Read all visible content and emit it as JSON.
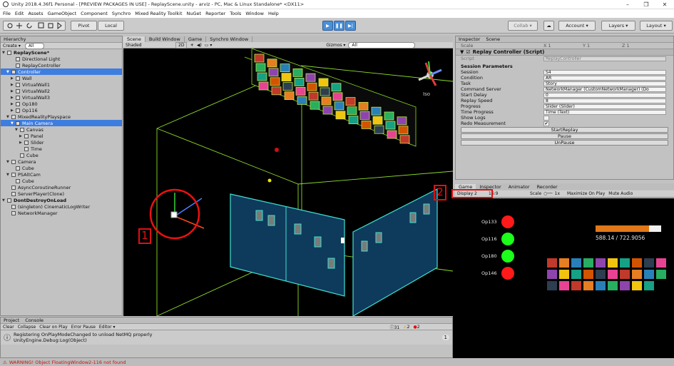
{
  "window": {
    "title": "Unity 2018.4.36f1 Personal - [PREVIEW PACKAGES IN USE] - ReplayScene.unity - arviz - PC, Mac & Linux Standalone* <DX11>",
    "controls": [
      "–",
      "❐",
      "✕"
    ]
  },
  "menu": [
    "File",
    "Edit",
    "Assets",
    "GameObject",
    "Component",
    "Synchro",
    "Mixed Reality Toolkit",
    "NuGet",
    "Reporter",
    "Tools",
    "Window",
    "Help"
  ],
  "toolbar": {
    "pivot": "Pivot",
    "local": "Local",
    "collab": "Collab ▾",
    "account": "Account ▾",
    "layers": "Layers ▾",
    "layout": "Layout ▾"
  },
  "hierarchy": {
    "tab": "Hierarchy",
    "create": "Create ▾",
    "search": "All",
    "rows": [
      {
        "text": "ReplayScene*",
        "indent": 0,
        "tri": "▼",
        "sel": false,
        "bold": true
      },
      {
        "text": "Directional Light",
        "indent": 2,
        "tri": "",
        "sel": false
      },
      {
        "text": "ReplayController",
        "indent": 2,
        "tri": "",
        "sel": false
      },
      {
        "text": "Controller",
        "indent": 1,
        "tri": "▼",
        "sel": true
      },
      {
        "text": "Wall",
        "indent": 2,
        "tri": "▶",
        "sel": false
      },
      {
        "text": "VirtualWall1",
        "indent": 2,
        "tri": "▶",
        "sel": false
      },
      {
        "text": "VirtualWall2",
        "indent": 2,
        "tri": "▶",
        "sel": false
      },
      {
        "text": "VirtualWall3",
        "indent": 2,
        "tri": "▶",
        "sel": false
      },
      {
        "text": "Op180",
        "indent": 2,
        "tri": "▶",
        "sel": false
      },
      {
        "text": "Op116",
        "indent": 2,
        "tri": "▶",
        "sel": false
      },
      {
        "text": "MixedRealityPlayspace",
        "indent": 1,
        "tri": "▼",
        "sel": false
      },
      {
        "text": "Main Camera",
        "indent": 2,
        "tri": "▼",
        "sel": true
      },
      {
        "text": "Canvas",
        "indent": 3,
        "tri": "▼",
        "sel": false
      },
      {
        "text": "Panel",
        "indent": 4,
        "tri": "▶",
        "sel": false
      },
      {
        "text": "Slider",
        "indent": 4,
        "tri": "▶",
        "sel": false
      },
      {
        "text": "Time",
        "indent": 4,
        "tri": "",
        "sel": false
      },
      {
        "text": "Cube",
        "indent": 3,
        "tri": "",
        "sel": false
      },
      {
        "text": "Camera",
        "indent": 1,
        "tri": "▼",
        "sel": false
      },
      {
        "text": "Cube",
        "indent": 2,
        "tri": "",
        "sel": false
      },
      {
        "text": "PSAltCam",
        "indent": 1,
        "tri": "▼",
        "sel": false
      },
      {
        "text": "Cube",
        "indent": 2,
        "tri": "",
        "sel": false
      },
      {
        "text": "AsyncCoroutineRunner",
        "indent": 1,
        "tri": "",
        "sel": false
      },
      {
        "text": "ServerPlayer(Clone)",
        "indent": 1,
        "tri": "",
        "sel": false
      },
      {
        "text": "DontDestroyOnLoad",
        "indent": 0,
        "tri": "▼",
        "sel": false,
        "bold": true
      },
      {
        "text": "(singleton) CinematicLogWriter",
        "indent": 1,
        "tri": "",
        "sel": false
      },
      {
        "text": "NetworkManager",
        "indent": 1,
        "tri": "",
        "sel": false
      }
    ]
  },
  "scene": {
    "tabs": [
      "Scene",
      "Build Window",
      "Game",
      "Synchro Window"
    ],
    "shading": "Shaded",
    "mode2d": "2D",
    "gizmos": "Gizmos ▾",
    "search": "All",
    "iso": "Iso"
  },
  "inspector": {
    "tabs": [
      "Inspector",
      "Scene"
    ],
    "scale_label": "Scale",
    "scale": [
      "X 1",
      "Y 1",
      "Z 1"
    ],
    "component": "Replay Controller (Script)",
    "script_label": "Script",
    "script_value": "ReplayController",
    "section": "Session Parameters",
    "fields": [
      {
        "label": "Session",
        "value": "S4"
      },
      {
        "label": "Condition",
        "value": "AR"
      },
      {
        "label": "Task",
        "value": "Story"
      },
      {
        "label": "Command Server",
        "value": "NetworkManager (CustomNetworkManager) (Do"
      },
      {
        "label": "Start Delay",
        "value": "0"
      },
      {
        "label": "Replay Speed",
        "value": "8"
      },
      {
        "label": "Progress",
        "value": "Slider (Slider)"
      },
      {
        "label": "Time Progress",
        "value": "Time (Text)"
      },
      {
        "label": "Show Logs",
        "value": ""
      },
      {
        "label": "Redo Measurement",
        "value": "✔"
      }
    ],
    "buttons": [
      "StartReplay",
      "Pause",
      "UnPause"
    ]
  },
  "game": {
    "tabs": [
      "Game",
      "Inspector",
      "Animator",
      "Recorder"
    ],
    "display": "Display 2",
    "aspect": "16:9",
    "scale": "Scale",
    "scale_value": "1x",
    "maximize": "Maximize On Play",
    "mute": "Mute Audio",
    "ops": [
      {
        "label": "Op133",
        "color": "#ff1a1a"
      },
      {
        "label": "Op116",
        "color": "#1bff1b"
      },
      {
        "label": "Op180",
        "color": "#1bff1b"
      },
      {
        "label": "Op146",
        "color": "#ff1a1a"
      }
    ],
    "progress": 0.81,
    "time_text": "588.14 / 722.9056"
  },
  "console": {
    "tabs": [
      "Project",
      "Console"
    ],
    "buttons": [
      "Clear",
      "Collapse",
      "Clear on Play",
      "Error Pause",
      "Editor ▾"
    ],
    "counts": [
      "31",
      "2",
      "2"
    ],
    "message_line1": "Registering OnPlayModeChanged to unload NetMQ properly",
    "message_line2": "UnityEngine.Debug:Log(Object)",
    "message_count": "1"
  },
  "status": "WARNING! Object FloatingWindow2-116 not found",
  "annotations": [
    "1",
    "2"
  ]
}
